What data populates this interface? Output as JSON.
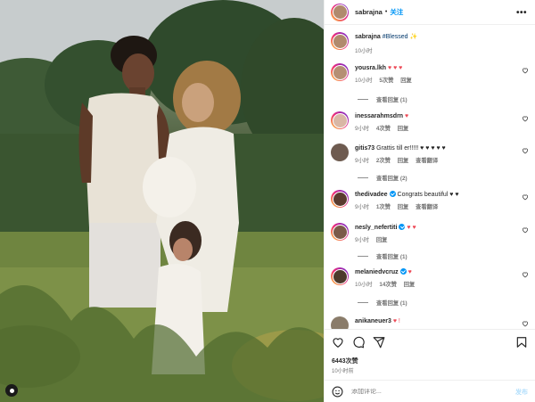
{
  "header": {
    "username": "sabrajna",
    "separator": "•",
    "follow_label": "关注",
    "more_icon": "more-horizontal-icon"
  },
  "caption": {
    "username": "sabrajna",
    "text": "#Blessed ✨",
    "time": "10小时"
  },
  "comments": [
    {
      "username": "yousra.lkh",
      "verified": false,
      "text": "♥ ♥ ♥",
      "time": "10小时",
      "likes": "5次赞",
      "reply": "回复",
      "translate": "",
      "replies_label": "查看回复 (1)",
      "avatar_color": "#b58f74"
    },
    {
      "username": "inessarahmsdrn",
      "verified": false,
      "text": "♥",
      "time": "9小时",
      "likes": "4次赞",
      "reply": "回复",
      "translate": "",
      "replies_label": "",
      "avatar_color": "#d9b7a5"
    },
    {
      "username": "gitis73",
      "verified": false,
      "text": "Grattis till er!!!!! ♥ ♥ ♥ ♥ ♥",
      "time": "9小时",
      "likes": "2次赞",
      "reply": "回复",
      "translate": "查看翻译",
      "replies_label": "查看回复 (2)",
      "avatar_color": "#6e5b50"
    },
    {
      "username": "thedivadee",
      "verified": true,
      "text": "Congrats beautiful ♥ ♥",
      "time": "9小时",
      "likes": "1次赞",
      "reply": "回复",
      "translate": "查看翻译",
      "replies_label": "",
      "avatar_color": "#5a3b2f"
    },
    {
      "username": "nesly_nefertiti",
      "verified": true,
      "text": "♥ ♥",
      "time": "9小时",
      "likes": "",
      "reply": "回复",
      "translate": "",
      "replies_label": "查看回复 (1)",
      "avatar_color": "#7b5a49"
    },
    {
      "username": "melaniedvcruz",
      "verified": true,
      "text": "♥",
      "time": "10小时",
      "likes": "14次赞",
      "reply": "回复",
      "translate": "",
      "replies_label": "查看回复 (1)",
      "avatar_color": "#4d3a2c"
    },
    {
      "username": "anikaneuer3",
      "verified": false,
      "text": "♥ !",
      "time": "",
      "likes": "",
      "reply": "",
      "translate": "",
      "replies_label": "",
      "avatar_color": "#8a7c6a"
    }
  ],
  "actions": {
    "likes": "6443次赞",
    "time": "10小时前"
  },
  "add_comment": {
    "placeholder": "添加评论...",
    "post_label": "发布"
  },
  "colors": {
    "link": "#0095f6",
    "heart": "#ed4956",
    "muted": "#737373"
  }
}
